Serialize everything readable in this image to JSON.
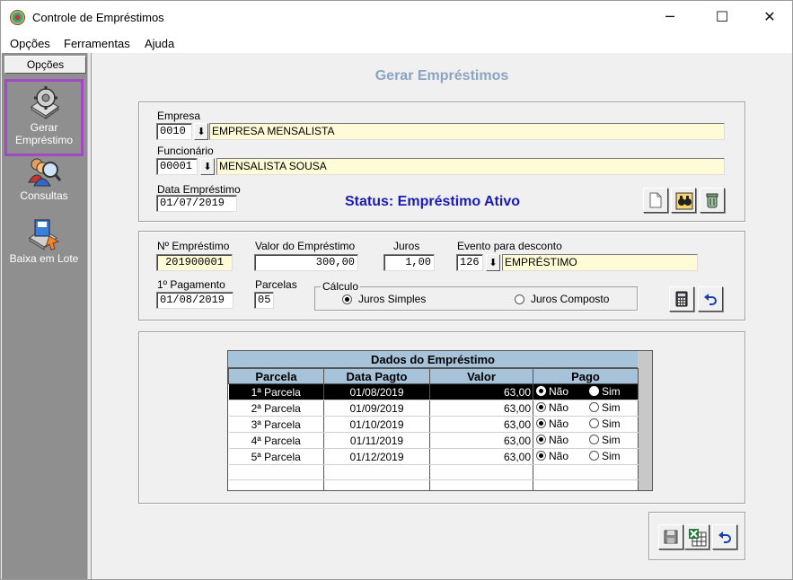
{
  "window": {
    "title": "Controle de Empréstimos",
    "minimize": "─",
    "maximize": "☐",
    "close": "✕"
  },
  "menu": [
    "Opções",
    "Ferramentas",
    "Ajuda"
  ],
  "sidebar": {
    "header": "Opções",
    "items": [
      {
        "label_line1": "Gerar",
        "label_line2": "Empréstimo",
        "icon": "gear-disk-icon",
        "active": true
      },
      {
        "label_line1": "Consultas",
        "label_line2": "",
        "icon": "search-users-icon",
        "active": false
      },
      {
        "label_line1": "Baixa em Lote",
        "label_line2": "",
        "icon": "batch-disk-icon",
        "active": false
      }
    ]
  },
  "page": {
    "title": "Gerar Empréstimos",
    "status": "Status: Empréstimo Ativo"
  },
  "form": {
    "empresa_label": "Empresa",
    "empresa_code": "0010",
    "empresa_name": "EMPRESA MENSALISTA",
    "funcionario_label": "Funcionário",
    "funcionario_code": "00001",
    "funcionario_name": "MENSALISTA SOUSA",
    "data_label": "Data Empréstimo",
    "data_value": "01/07/2019",
    "numero_label": "Nº Empréstimo",
    "numero_value": "201900001",
    "valor_label": "Valor do Empréstimo",
    "valor_value": "300,00",
    "juros_label": "Juros",
    "juros_value": "1,00",
    "evento_label": "Evento para desconto",
    "evento_code": "126",
    "evento_name": "EMPRÉSTIMO",
    "pagamento_label": "1º Pagamento",
    "pagamento_value": "01/08/2019",
    "parcelas_label": "Parcelas",
    "parcelas_value": "05",
    "calculo_label": "Cálculo",
    "calculo_options": [
      "Juros Simples",
      "Juros Composto"
    ],
    "calculo_selected": "Juros Simples"
  },
  "grid": {
    "title": "Dados do Empréstimo",
    "columns": [
      "Parcela",
      "Data Pagto",
      "Valor",
      "Pago"
    ],
    "pago_options": [
      "Não",
      "Sim"
    ],
    "rows": [
      {
        "parcela": "1ª Parcela",
        "data": "01/08/2019",
        "valor": "63,00",
        "pago": "Não"
      },
      {
        "parcela": "2ª Parcela",
        "data": "01/09/2019",
        "valor": "63,00",
        "pago": "Não"
      },
      {
        "parcela": "3ª Parcela",
        "data": "01/10/2019",
        "valor": "63,00",
        "pago": "Não"
      },
      {
        "parcela": "4ª Parcela",
        "data": "01/11/2019",
        "valor": "63,00",
        "pago": "Não"
      },
      {
        "parcela": "5ª Parcela",
        "data": "01/12/2019",
        "valor": "63,00",
        "pago": "Não"
      }
    ],
    "selected_row": 0
  }
}
